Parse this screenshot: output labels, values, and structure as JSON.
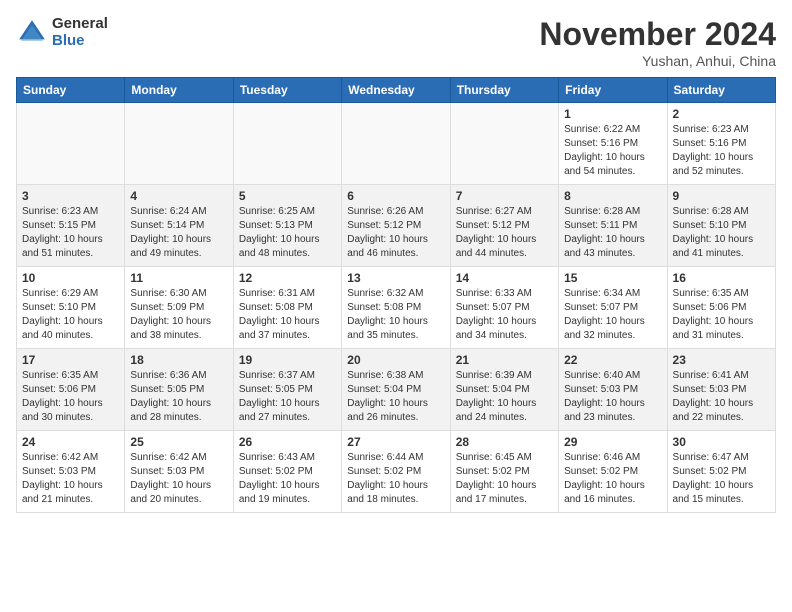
{
  "header": {
    "logo_general": "General",
    "logo_blue": "Blue",
    "month_title": "November 2024",
    "location": "Yushan, Anhui, China"
  },
  "weekdays": [
    "Sunday",
    "Monday",
    "Tuesday",
    "Wednesday",
    "Thursday",
    "Friday",
    "Saturday"
  ],
  "weeks": [
    [
      {
        "day": "",
        "info": ""
      },
      {
        "day": "",
        "info": ""
      },
      {
        "day": "",
        "info": ""
      },
      {
        "day": "",
        "info": ""
      },
      {
        "day": "",
        "info": ""
      },
      {
        "day": "1",
        "info": "Sunrise: 6:22 AM\nSunset: 5:16 PM\nDaylight: 10 hours\nand 54 minutes."
      },
      {
        "day": "2",
        "info": "Sunrise: 6:23 AM\nSunset: 5:16 PM\nDaylight: 10 hours\nand 52 minutes."
      }
    ],
    [
      {
        "day": "3",
        "info": "Sunrise: 6:23 AM\nSunset: 5:15 PM\nDaylight: 10 hours\nand 51 minutes."
      },
      {
        "day": "4",
        "info": "Sunrise: 6:24 AM\nSunset: 5:14 PM\nDaylight: 10 hours\nand 49 minutes."
      },
      {
        "day": "5",
        "info": "Sunrise: 6:25 AM\nSunset: 5:13 PM\nDaylight: 10 hours\nand 48 minutes."
      },
      {
        "day": "6",
        "info": "Sunrise: 6:26 AM\nSunset: 5:12 PM\nDaylight: 10 hours\nand 46 minutes."
      },
      {
        "day": "7",
        "info": "Sunrise: 6:27 AM\nSunset: 5:12 PM\nDaylight: 10 hours\nand 44 minutes."
      },
      {
        "day": "8",
        "info": "Sunrise: 6:28 AM\nSunset: 5:11 PM\nDaylight: 10 hours\nand 43 minutes."
      },
      {
        "day": "9",
        "info": "Sunrise: 6:28 AM\nSunset: 5:10 PM\nDaylight: 10 hours\nand 41 minutes."
      }
    ],
    [
      {
        "day": "10",
        "info": "Sunrise: 6:29 AM\nSunset: 5:10 PM\nDaylight: 10 hours\nand 40 minutes."
      },
      {
        "day": "11",
        "info": "Sunrise: 6:30 AM\nSunset: 5:09 PM\nDaylight: 10 hours\nand 38 minutes."
      },
      {
        "day": "12",
        "info": "Sunrise: 6:31 AM\nSunset: 5:08 PM\nDaylight: 10 hours\nand 37 minutes."
      },
      {
        "day": "13",
        "info": "Sunrise: 6:32 AM\nSunset: 5:08 PM\nDaylight: 10 hours\nand 35 minutes."
      },
      {
        "day": "14",
        "info": "Sunrise: 6:33 AM\nSunset: 5:07 PM\nDaylight: 10 hours\nand 34 minutes."
      },
      {
        "day": "15",
        "info": "Sunrise: 6:34 AM\nSunset: 5:07 PM\nDaylight: 10 hours\nand 32 minutes."
      },
      {
        "day": "16",
        "info": "Sunrise: 6:35 AM\nSunset: 5:06 PM\nDaylight: 10 hours\nand 31 minutes."
      }
    ],
    [
      {
        "day": "17",
        "info": "Sunrise: 6:35 AM\nSunset: 5:06 PM\nDaylight: 10 hours\nand 30 minutes."
      },
      {
        "day": "18",
        "info": "Sunrise: 6:36 AM\nSunset: 5:05 PM\nDaylight: 10 hours\nand 28 minutes."
      },
      {
        "day": "19",
        "info": "Sunrise: 6:37 AM\nSunset: 5:05 PM\nDaylight: 10 hours\nand 27 minutes."
      },
      {
        "day": "20",
        "info": "Sunrise: 6:38 AM\nSunset: 5:04 PM\nDaylight: 10 hours\nand 26 minutes."
      },
      {
        "day": "21",
        "info": "Sunrise: 6:39 AM\nSunset: 5:04 PM\nDaylight: 10 hours\nand 24 minutes."
      },
      {
        "day": "22",
        "info": "Sunrise: 6:40 AM\nSunset: 5:03 PM\nDaylight: 10 hours\nand 23 minutes."
      },
      {
        "day": "23",
        "info": "Sunrise: 6:41 AM\nSunset: 5:03 PM\nDaylight: 10 hours\nand 22 minutes."
      }
    ],
    [
      {
        "day": "24",
        "info": "Sunrise: 6:42 AM\nSunset: 5:03 PM\nDaylight: 10 hours\nand 21 minutes."
      },
      {
        "day": "25",
        "info": "Sunrise: 6:42 AM\nSunset: 5:03 PM\nDaylight: 10 hours\nand 20 minutes."
      },
      {
        "day": "26",
        "info": "Sunrise: 6:43 AM\nSunset: 5:02 PM\nDaylight: 10 hours\nand 19 minutes."
      },
      {
        "day": "27",
        "info": "Sunrise: 6:44 AM\nSunset: 5:02 PM\nDaylight: 10 hours\nand 18 minutes."
      },
      {
        "day": "28",
        "info": "Sunrise: 6:45 AM\nSunset: 5:02 PM\nDaylight: 10 hours\nand 17 minutes."
      },
      {
        "day": "29",
        "info": "Sunrise: 6:46 AM\nSunset: 5:02 PM\nDaylight: 10 hours\nand 16 minutes."
      },
      {
        "day": "30",
        "info": "Sunrise: 6:47 AM\nSunset: 5:02 PM\nDaylight: 10 hours\nand 15 minutes."
      }
    ]
  ]
}
